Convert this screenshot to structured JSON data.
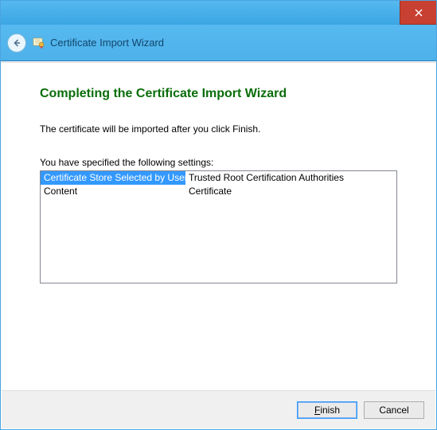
{
  "window": {
    "title": "Certificate Import Wizard"
  },
  "main": {
    "heading": "Completing the Certificate Import Wizard",
    "description": "The certificate will be imported after you click Finish.",
    "settings_label": "You have specified the following settings:",
    "rows": [
      {
        "label": "Certificate Store Selected by User",
        "value": "Trusted Root Certification Authorities",
        "selected": true
      },
      {
        "label": "Content",
        "value": "Certificate",
        "selected": false
      }
    ]
  },
  "footer": {
    "finish": "Finish",
    "cancel": "Cancel"
  }
}
